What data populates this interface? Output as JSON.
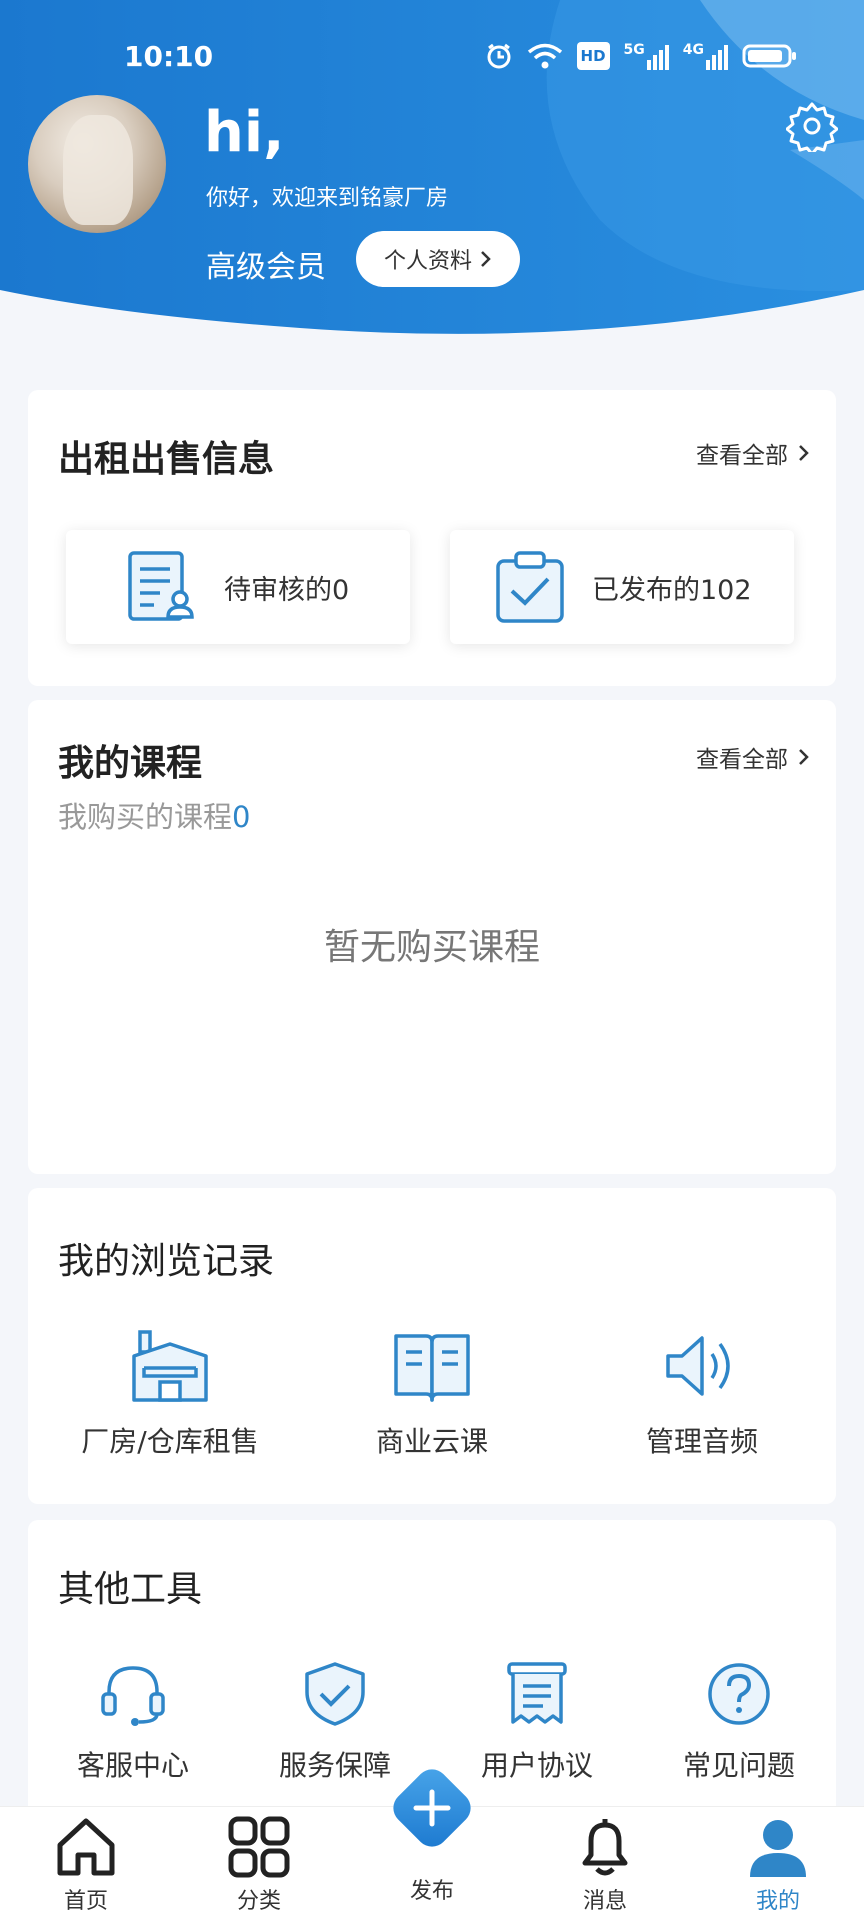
{
  "status_bar": {
    "time": "10:10",
    "network_labels": [
      "HD",
      "5G",
      "4G"
    ]
  },
  "header": {
    "greeting": "hi,",
    "welcome": "你好，欢迎来到铭豪厂房",
    "member_level": "高级会员",
    "profile_button": "个人资料",
    "settings_icon": "gear-icon",
    "brand_color": "#1b7cd0"
  },
  "rent_sale": {
    "title": "出租出售信息",
    "view_all": "查看全部",
    "pending_label": "待审核的0",
    "published_label": "已发布的102"
  },
  "courses": {
    "title": "我的课程",
    "view_all": "查看全部",
    "purchased_label": "我购买的课程",
    "purchased_count": "0",
    "empty_text": "暂无购买课程"
  },
  "history": {
    "title": "我的浏览记录",
    "items": [
      {
        "label": "厂房/仓库租售",
        "icon": "factory-icon"
      },
      {
        "label": "商业云课",
        "icon": "book-icon"
      },
      {
        "label": "管理音频",
        "icon": "speaker-icon"
      }
    ]
  },
  "tools": {
    "title": "其他工具",
    "items": [
      {
        "label": "客服中心",
        "icon": "headset-icon"
      },
      {
        "label": "服务保障",
        "icon": "shield-check-icon"
      },
      {
        "label": "用户协议",
        "icon": "document-icon"
      },
      {
        "label": "常见问题",
        "icon": "question-icon"
      }
    ]
  },
  "bottom_nav": {
    "items": [
      {
        "label": "首页",
        "icon": "home-icon"
      },
      {
        "label": "分类",
        "icon": "grid-icon"
      },
      {
        "label": "发布",
        "icon": "plus-icon"
      },
      {
        "label": "消息",
        "icon": "bell-icon"
      },
      {
        "label": "我的",
        "icon": "user-icon",
        "active": true
      }
    ],
    "active_color": "#2f86c8"
  }
}
